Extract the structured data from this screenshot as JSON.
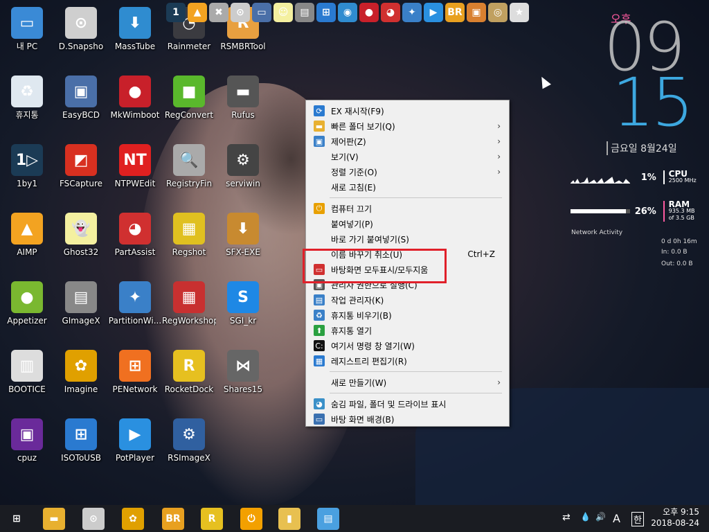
{
  "desktop_icons": [
    {
      "label": "내 PC",
      "icon": "computer-icon",
      "color": "#3a8ad6",
      "glyph": "▭"
    },
    {
      "label": "D.Snapsho",
      "icon": "drive-icon",
      "color": "#cfcfcf",
      "glyph": "⊙"
    },
    {
      "label": "MassTube",
      "icon": "download-globe-icon",
      "color": "#2f8cd0",
      "glyph": "⬇"
    },
    {
      "label": "Rainmeter",
      "icon": "rainmeter-icon",
      "color": "#3b3b40",
      "glyph": "◔"
    },
    {
      "label": "RSMBRTool",
      "icon": "rsmbr-tool-icon",
      "color": "#e8a040",
      "glyph": "R"
    },
    {
      "label": "휴지통",
      "icon": "recycle-bin-icon",
      "color": "#dfe8f0",
      "glyph": "♻"
    },
    {
      "label": "EasyBCD",
      "icon": "easybcd-icon",
      "color": "#4a6fa8",
      "glyph": "▣"
    },
    {
      "label": "MkWimboot",
      "icon": "ladybug-icon",
      "color": "#c8202a",
      "glyph": "●"
    },
    {
      "label": "RegConvert",
      "icon": "regconvert-icon",
      "color": "#5ab82c",
      "glyph": "■"
    },
    {
      "label": "Rufus",
      "icon": "usb-drive-icon",
      "color": "#555",
      "glyph": "▬"
    },
    {
      "label": "1by1",
      "icon": "1by1-icon",
      "color": "#1b3b55",
      "glyph": "1▷"
    },
    {
      "label": "FSCapture",
      "icon": "fscapture-icon",
      "color": "#d83020",
      "glyph": "◩"
    },
    {
      "label": "NTPWEdit",
      "icon": "key-icon",
      "color": "#e02020",
      "glyph": "NT"
    },
    {
      "label": "RegistryFin",
      "icon": "magnifier-icon",
      "color": "#aaa",
      "glyph": "🔍"
    },
    {
      "label": "serviwin",
      "icon": "serviwin-icon",
      "color": "#444",
      "glyph": "⚙"
    },
    {
      "label": "AIMP",
      "icon": "aimp-icon",
      "color": "#f3a321",
      "glyph": "▲"
    },
    {
      "label": "Ghost32",
      "icon": "ghost-icon",
      "color": "#f4f0a0",
      "glyph": "👻"
    },
    {
      "label": "PartAssist",
      "icon": "partassist-icon",
      "color": "#d03030",
      "glyph": "◕"
    },
    {
      "label": "Regshot",
      "icon": "regshot-icon",
      "color": "#e0c020",
      "glyph": "▦"
    },
    {
      "label": "SFX-EXE",
      "icon": "sfx-box-icon",
      "color": "#c88a30",
      "glyph": "⬇"
    },
    {
      "label": "Appetizer",
      "icon": "appetizer-icon",
      "color": "#7ab830",
      "glyph": "●"
    },
    {
      "label": "GImageX",
      "icon": "gimagex-icon",
      "color": "#888",
      "glyph": "▤"
    },
    {
      "label": "PartitionWi...",
      "icon": "partition-wizard-icon",
      "color": "#3a80c8",
      "glyph": "✦"
    },
    {
      "label": "RegWorkshop",
      "icon": "regworkshop-icon",
      "color": "#c83030",
      "glyph": "▦"
    },
    {
      "label": "SGI_kr",
      "icon": "sgi-icon",
      "color": "#1e88e5",
      "glyph": "S"
    },
    {
      "label": "BOOTICE",
      "icon": "bootice-icon",
      "color": "#ddd",
      "glyph": "▥"
    },
    {
      "label": "Imagine",
      "icon": "sunflower-icon",
      "color": "#e0a000",
      "glyph": "✿"
    },
    {
      "label": "PENetwork",
      "icon": "network-icon",
      "color": "#f07020",
      "glyph": "⊞"
    },
    {
      "label": "RocketDock",
      "icon": "rocketdock-icon",
      "color": "#e6c020",
      "glyph": "R"
    },
    {
      "label": "Shares15",
      "icon": "share-icon",
      "color": "#666",
      "glyph": "⋈"
    },
    {
      "label": "cpuz",
      "icon": "cpu-icon",
      "color": "#6a2a9a",
      "glyph": "▣"
    },
    {
      "label": "ISOToUSB",
      "icon": "iso-usb-icon",
      "color": "#2a7ad0",
      "glyph": "⊞"
    },
    {
      "label": "PotPlayer",
      "icon": "play-icon",
      "color": "#2a90e0",
      "glyph": "▶"
    },
    {
      "label": "RSImageX",
      "icon": "rsimagex-icon",
      "color": "#3060a0",
      "glyph": "⚙"
    }
  ],
  "quickbar": [
    {
      "icon": "1by1-icon",
      "color": "#1b3b55",
      "glyph": "1"
    },
    {
      "icon": "aimp-icon",
      "color": "#f3a321",
      "glyph": "▲"
    },
    {
      "icon": "tools-icon",
      "color": "#aaa",
      "glyph": "✖"
    },
    {
      "icon": "drive-icon",
      "color": "#ccc",
      "glyph": "⊙"
    },
    {
      "icon": "laptop-icon",
      "color": "#4a6fa8",
      "glyph": "▭"
    },
    {
      "icon": "ghost-icon",
      "color": "#f4f0a0",
      "glyph": "☺"
    },
    {
      "icon": "gimagex-icon",
      "color": "#888",
      "glyph": "▤"
    },
    {
      "icon": "windows-icon",
      "color": "#2a7ad0",
      "glyph": "⊞"
    },
    {
      "icon": "globe-icon",
      "color": "#2f8cd0",
      "glyph": "◉"
    },
    {
      "icon": "ladybug-icon",
      "color": "#c8202a",
      "glyph": "●"
    },
    {
      "icon": "partassist-icon",
      "color": "#d03030",
      "glyph": "◕"
    },
    {
      "icon": "wand-icon",
      "color": "#3a80c8",
      "glyph": "✦"
    },
    {
      "icon": "play-icon",
      "color": "#2a90e0",
      "glyph": "▶"
    },
    {
      "icon": "br-icon",
      "color": "#e8a020",
      "glyph": "BR"
    },
    {
      "icon": "camera-icon",
      "color": "#d88030",
      "glyph": "▣"
    },
    {
      "icon": "disc-icon",
      "color": "#c0a060",
      "glyph": "◎"
    },
    {
      "icon": "bag-icon",
      "color": "#ddd",
      "glyph": "★"
    }
  ],
  "clock": {
    "ampm": "오후",
    "hour": "09",
    "minute": "15",
    "date": "금요일 8월24일"
  },
  "meters": {
    "cpu_pct": "1%",
    "cpu_label": "CPU",
    "cpu_sub": "2500 MHz",
    "ram_pct": "26%",
    "ram_label": "RAM",
    "ram_sub1": "935.3 MB",
    "ram_sub2": "of  3.5 GB",
    "net_title": "Network Activity",
    "net_uptime": "0 d 0h 16m",
    "net_in": "In: 0.0 B",
    "net_out": "Out: 0.0 B"
  },
  "context_menu": {
    "items": [
      {
        "label": "EX 재시작(F9)",
        "icon": "refresh-icon",
        "glyph": "⟳",
        "color": "#2a7ad0",
        "arrow": false,
        "shortcut": ""
      },
      {
        "label": "빠른 폴더 보기(Q)",
        "icon": "folder-icon",
        "glyph": "▬",
        "color": "#e8b030",
        "arrow": true,
        "shortcut": ""
      },
      {
        "label": "제어판(Z)",
        "icon": "control-panel-icon",
        "glyph": "▣",
        "color": "#3a80c8",
        "arrow": true,
        "shortcut": ""
      },
      {
        "label": "보기(V)",
        "icon": "",
        "glyph": "",
        "color": "",
        "arrow": true,
        "shortcut": ""
      },
      {
        "label": "정렬 기준(O)",
        "icon": "",
        "glyph": "",
        "color": "",
        "arrow": true,
        "shortcut": ""
      },
      {
        "label": "새로 고침(E)",
        "icon": "",
        "glyph": "",
        "color": "",
        "arrow": false,
        "shortcut": ""
      },
      {
        "sep": true
      },
      {
        "label": "컴퓨터 끄기",
        "icon": "power-icon",
        "glyph": "⏻",
        "color": "#e8a000",
        "arrow": false,
        "shortcut": ""
      },
      {
        "label": "붙여넣기(P)",
        "icon": "",
        "glyph": "",
        "color": "",
        "arrow": false,
        "shortcut": ""
      },
      {
        "label": "바로 가기 붙여넣기(S)",
        "icon": "",
        "glyph": "",
        "color": "",
        "arrow": false,
        "shortcut": ""
      },
      {
        "label": "이름 바꾸기 취소(U)",
        "icon": "",
        "glyph": "",
        "color": "",
        "arrow": false,
        "shortcut": "Ctrl+Z"
      },
      {
        "label": "바탕화면 모두표시/모두지움",
        "icon": "monitor-icon",
        "glyph": "▭",
        "color": "#d03030",
        "arrow": false,
        "shortcut": ""
      },
      {
        "label": "관리자 권한으로 실행(C)",
        "icon": "admin-icon",
        "glyph": "▣",
        "color": "#555",
        "arrow": false,
        "shortcut": ""
      },
      {
        "label": "작업 관리자(K)",
        "icon": "task-manager-icon",
        "glyph": "▤",
        "color": "#3a80c8",
        "arrow": false,
        "shortcut": ""
      },
      {
        "label": "휴지통 비우기(B)",
        "icon": "recycle-bin-icon",
        "glyph": "♻",
        "color": "#3a80c8",
        "arrow": false,
        "shortcut": ""
      },
      {
        "label": "휴지통 열기",
        "icon": "up-arrow-icon",
        "glyph": "⬆",
        "color": "#2aa040",
        "arrow": false,
        "shortcut": ""
      },
      {
        "label": "여기서 명령 창 열기(W)",
        "icon": "cmd-icon",
        "glyph": "C:",
        "color": "#111",
        "arrow": false,
        "shortcut": ""
      },
      {
        "label": "레지스트리 편집기(R)",
        "icon": "registry-icon",
        "glyph": "▦",
        "color": "#2a7ad0",
        "arrow": false,
        "shortcut": ""
      },
      {
        "sep": true
      },
      {
        "label": "새로 만들기(W)",
        "icon": "",
        "glyph": "",
        "color": "",
        "arrow": true,
        "shortcut": ""
      },
      {
        "sep": true
      },
      {
        "label": "숨김 파일, 폴더 및 드라이브 표시",
        "icon": "hidden-files-icon",
        "glyph": "◕",
        "color": "#3a90c8",
        "arrow": false,
        "shortcut": ""
      },
      {
        "label": "바탕 화면 배경(B)",
        "icon": "wallpaper-icon",
        "glyph": "▭",
        "color": "#3a70b0",
        "arrow": false,
        "shortcut": ""
      }
    ]
  },
  "taskbar": {
    "apps": [
      {
        "icon": "windows-start-icon",
        "color": "#1a1c22",
        "glyph": "⊞"
      },
      {
        "icon": "file-explorer-icon",
        "color": "#e8b030",
        "glyph": "▬"
      },
      {
        "icon": "drive-icon",
        "color": "#ccc",
        "glyph": "⊙"
      },
      {
        "icon": "sunflower-icon",
        "color": "#e0a000",
        "glyph": "✿"
      },
      {
        "icon": "br-icon",
        "color": "#e8a020",
        "glyph": "BR"
      },
      {
        "icon": "rocketdock-icon",
        "color": "#e6c020",
        "glyph": "R"
      },
      {
        "icon": "power-icon",
        "color": "#f3a000",
        "glyph": "⏻"
      },
      {
        "icon": "folder-icon",
        "color": "#e8c050",
        "glyph": "▮"
      },
      {
        "icon": "notepad-icon",
        "color": "#4aa0e0",
        "glyph": "▤"
      }
    ],
    "tray": {
      "network": "⇄",
      "drop": "💧",
      "volume": "🔊",
      "ime_a": "A",
      "ime_han": "한"
    },
    "time": "오후 9:15",
    "date": "2018-08-24"
  }
}
